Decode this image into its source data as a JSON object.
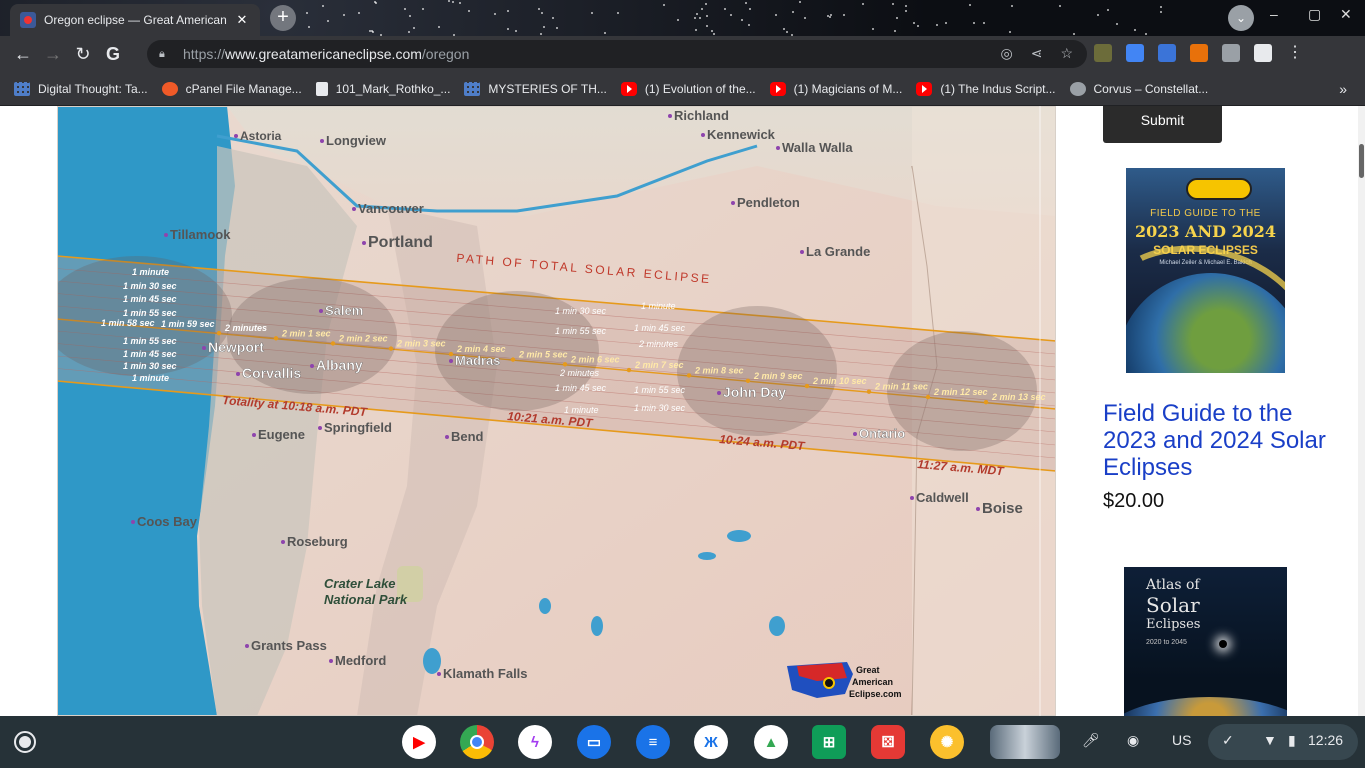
{
  "browser": {
    "tab_title": "Oregon eclipse — Great American",
    "tab_close": "✕",
    "new_tab": "+",
    "url_scheme": "https://",
    "url_host": "www.greatamericaneclipse.com",
    "url_path": "/oregon",
    "bookmarks": [
      {
        "label": "Digital Thought: Ta...",
        "icon": "grid"
      },
      {
        "label": "cPanel File Manage...",
        "icon": "cpanel"
      },
      {
        "label": "101_Mark_Rothko_...",
        "icon": "doc"
      },
      {
        "label": "MYSTERIES OF TH...",
        "icon": "grid"
      },
      {
        "label": "(1) Evolution of the...",
        "icon": "youtube"
      },
      {
        "label": "(1) Magicians of M...",
        "icon": "youtube"
      },
      {
        "label": "(1) The Indus Script...",
        "icon": "youtube"
      },
      {
        "label": "Corvus – Constellat...",
        "icon": "globe"
      }
    ],
    "bookmarks_overflow": "»"
  },
  "map": {
    "path_title": "PATH OF TOTAL SOLAR ECLIPSE",
    "totality_start": "Totality at 10:18 a.m. PDT",
    "time_1021": "10:21 a.m. PDT",
    "time_1024": "10:24 a.m. PDT",
    "time_1127": "11:27 a.m. MDT",
    "crater_lake": [
      "Crater Lake",
      "National Park"
    ],
    "logo_text": [
      "Great",
      "American",
      "Eclipse.com"
    ],
    "cities": {
      "astoria": "Astoria",
      "longview": "Longview",
      "richland": "Richland",
      "kennewick": "Kennewick",
      "walla_walla": "Walla Walla",
      "vancouver": "Vancouver",
      "portland": "Portland",
      "tillamook": "Tillamook",
      "pendleton": "Pendleton",
      "la_grande": "La Grande",
      "salem": "Salem",
      "newport": "Newport",
      "albany": "Albany",
      "corvallis": "Corvallis",
      "madras": "Madras",
      "john_day": "John Day",
      "ontario": "Ontario",
      "eugene": "Eugene",
      "springfield": "Springfield",
      "bend": "Bend",
      "caldwell": "Caldwell",
      "boise": "Boise",
      "coos_bay": "Coos Bay",
      "roseburg": "Roseburg",
      "grants_pass": "Grants Pass",
      "medford": "Medford",
      "klamath_falls": "Klamath Falls"
    },
    "left_durations": [
      "1 minute",
      "1 min 30 sec",
      "1 min 45 sec",
      "1 min 55 sec",
      "1 min 58 sec",
      "1 min 59 sec",
      "1 min 55 sec",
      "1 min 45 sec",
      "1 min 30 sec",
      "1 minute"
    ],
    "center_durations": [
      "2 minutes",
      "2 min 1 sec",
      "2 min 2 sec",
      "2 min 3 sec",
      "2 min 4 sec",
      "2 min 5 sec",
      "2 min 6 sec",
      "2 min 7 sec",
      "2 min 8 sec",
      "2 min 9 sec",
      "2 min 10 sec",
      "2 min 11 sec",
      "2 min 12 sec",
      "2 min 13 sec"
    ],
    "madras_durations": [
      "1 min 30 sec",
      "1 min 55 sec",
      "2 minutes",
      "1 min 45 sec",
      "1 minute"
    ],
    "east_durations": [
      "1 minute",
      "1 min 45 sec",
      "2 minutes",
      "1 min 55 sec",
      "1 min 30 sec"
    ]
  },
  "sidebar": {
    "submit_label": "Submit",
    "book1_cover": {
      "line1": "FIELD GUIDE TO THE",
      "line2": "2023 AND 2024",
      "line3": "SOLAR ECLIPSES",
      "authors": "Michael Zeiler & Michael E. Bakich"
    },
    "product_title": "Field Guide to the 2023 and 2024 Solar Eclipses",
    "price": "$20.00",
    "book2_cover": {
      "line1": "Atlas of",
      "line2": "Solar",
      "line3": "Eclipses",
      "line4": "2020 to 2045"
    }
  },
  "shelf": {
    "apps": [
      "youtube",
      "chrome",
      "messenger",
      "files",
      "messages",
      "butterfly",
      "drive",
      "sheets",
      "dice",
      "lemon",
      "window-preview"
    ],
    "locale": "US",
    "time": "12:26"
  }
}
